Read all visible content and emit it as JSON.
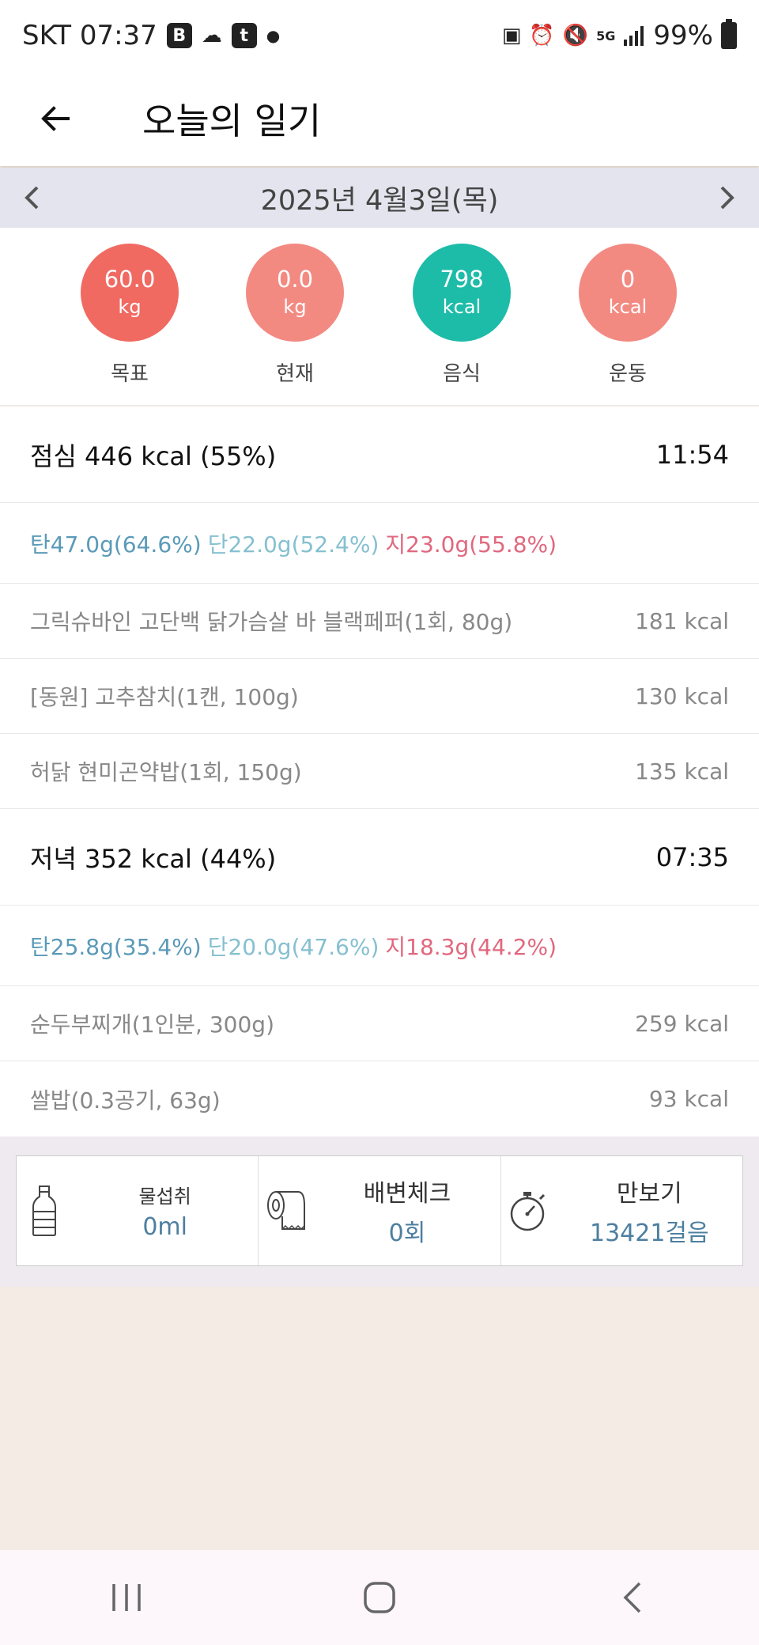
{
  "status_bar": {
    "carrier_time": "SKT 07:37",
    "left_icons": [
      "b-app-icon",
      "cloud-icon",
      "t-app-icon",
      "dot-icon"
    ],
    "right_icons": [
      "battery-saver-icon",
      "alarm-icon",
      "mute-icon",
      "5g-icon",
      "signal-icon"
    ],
    "battery_text": "99%",
    "network_label": "5G"
  },
  "app_bar": {
    "title": "오늘의 일기",
    "back_icon": "arrow-left-icon"
  },
  "date_bar": {
    "date": "2025년 4월3일(목)",
    "prev_icon": "chevron-left-icon",
    "next_icon": "chevron-right-icon"
  },
  "summary": [
    {
      "value": "60.0",
      "unit": "kg",
      "label": "목표",
      "color": "#f06a62"
    },
    {
      "value": "0.0",
      "unit": "kg",
      "label": "현재",
      "color": "#f38a82"
    },
    {
      "value": "798",
      "unit": "kcal",
      "label": "음식",
      "color": "#1dbca8"
    },
    {
      "value": "0",
      "unit": "kcal",
      "label": "운동",
      "color": "#f38a82"
    }
  ],
  "meals": [
    {
      "header": "점심 446 kcal (55%)",
      "time": "11:54",
      "carb": "탄47.0g(64.6%)",
      "protein": "단22.0g(52.4%)",
      "fat": "지23.0g(55.8%)",
      "foods": [
        {
          "name": "그릭슈바인 고단백 닭가슴살 바 블랙페퍼(1회, 80g)",
          "kcal": "181 kcal"
        },
        {
          "name": "[동원] 고추참치(1캔, 100g)",
          "kcal": "130 kcal"
        },
        {
          "name": "허닭 현미곤약밥(1회, 150g)",
          "kcal": "135 kcal"
        }
      ]
    },
    {
      "header": "저녁 352 kcal (44%)",
      "time": "07:35",
      "carb": "탄25.8g(35.4%)",
      "protein": "단20.0g(47.6%)",
      "fat": "지18.3g(44.2%)",
      "foods": [
        {
          "name": "순두부찌개(1인분, 300g)",
          "kcal": "259 kcal"
        },
        {
          "name": "쌀밥(0.3공기, 63g)",
          "kcal": "93 kcal"
        }
      ]
    }
  ],
  "widgets": [
    {
      "icon": "water-bottle-icon",
      "label": "물섭취",
      "value": "0ml"
    },
    {
      "icon": "toilet-paper-icon",
      "label": "배변체크",
      "value": "0회"
    },
    {
      "icon": "stopwatch-icon",
      "label": "만보기",
      "value": "13421걸음"
    }
  ],
  "nav_bar": {
    "icons": [
      "recent-apps-icon",
      "home-icon",
      "back-nav-icon"
    ]
  },
  "colors": {
    "carb": "#5a9ab8",
    "protein": "#86c0d0",
    "fat": "#e0687e",
    "page_background": "#f4ece4",
    "date_bar": "#e4e4ee"
  }
}
